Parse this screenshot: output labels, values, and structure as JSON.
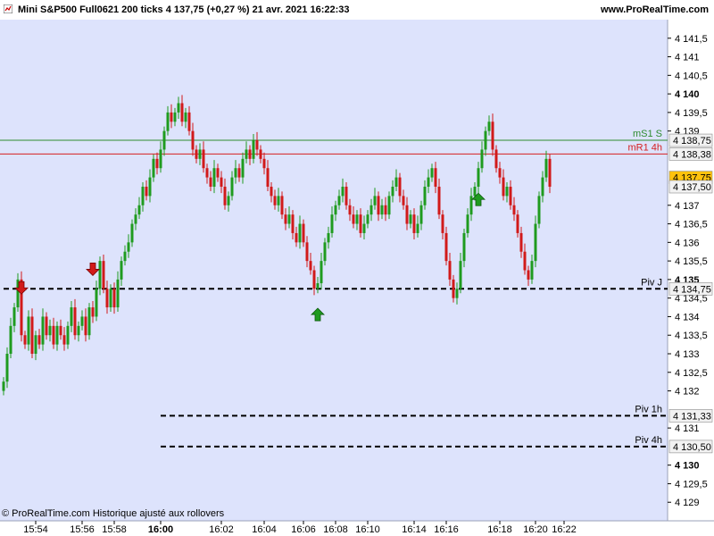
{
  "header": {
    "title": "Mini S&P500 Full0621 200 ticks 4 137,75 (+0,27 %) 21 avr. 2021 16:22:33",
    "site": "www.ProRealTime.com"
  },
  "footer": {
    "credit": "© ProRealTime.com Historique ajusté aux rollovers"
  },
  "colors": {
    "background": "#dde3fc",
    "up": "#1f9b1f",
    "down": "#d11a1a",
    "support_line": "#2e8b2e",
    "resistance_line": "#d42020",
    "last_price_badge": "#ffc20e"
  },
  "chart_data": {
    "type": "candlestick",
    "instrument": "Mini S&P500 Full0621",
    "ylim": [
      4128.5,
      4142
    ],
    "y_ticks": [
      {
        "value": 4141.5,
        "label": "4 141,5"
      },
      {
        "value": 4141,
        "label": "4 141"
      },
      {
        "value": 4140.5,
        "label": "4 140,5"
      },
      {
        "value": 4140,
        "label": "4 140",
        "bold": true
      },
      {
        "value": 4139.5,
        "label": "4 139,5"
      },
      {
        "value": 4139,
        "label": "4 139"
      },
      {
        "value": 4137,
        "label": "4 137"
      },
      {
        "value": 4136.5,
        "label": "4 136,5"
      },
      {
        "value": 4136,
        "label": "4 136"
      },
      {
        "value": 4135.5,
        "label": "4 135,5"
      },
      {
        "value": 4135,
        "label": "4 135",
        "bold": true
      },
      {
        "value": 4134.5,
        "label": "4 134,5"
      },
      {
        "value": 4134,
        "label": "4 134"
      },
      {
        "value": 4133.5,
        "label": "4 133,5"
      },
      {
        "value": 4133,
        "label": "4 133"
      },
      {
        "value": 4132.5,
        "label": "4 132,5"
      },
      {
        "value": 4132,
        "label": "4 132"
      },
      {
        "value": 4131,
        "label": "4 131"
      },
      {
        "value": 4130,
        "label": "4 130",
        "bold": true
      },
      {
        "value": 4129.5,
        "label": "4 129,5"
      },
      {
        "value": 4129,
        "label": "4 129"
      }
    ],
    "x_ticks": [
      {
        "label": "15:54",
        "bar": 9
      },
      {
        "label": "15:56",
        "bar": 22
      },
      {
        "label": "15:58",
        "bar": 31
      },
      {
        "label": "16:00",
        "bar": 44,
        "bold": true
      },
      {
        "label": "16:02",
        "bar": 61
      },
      {
        "label": "16:04",
        "bar": 73
      },
      {
        "label": "16:06",
        "bar": 84
      },
      {
        "label": "16:08",
        "bar": 93
      },
      {
        "label": "16:10",
        "bar": 102
      },
      {
        "label": "16:14",
        "bar": 115
      },
      {
        "label": "16:16",
        "bar": 124
      },
      {
        "label": "16:18",
        "bar": 139
      },
      {
        "label": "16:20",
        "bar": 149
      },
      {
        "label": "16:22",
        "bar": 157
      }
    ],
    "levels": [
      {
        "name": "mS1 S",
        "value": 4138.75,
        "label": "4 138,75",
        "style": "solid",
        "color": "#2e8b2e",
        "badge": "light"
      },
      {
        "name": "mR1 4h",
        "value": 4138.38,
        "label": "4 138,38",
        "style": "solid",
        "color": "#d42020",
        "badge": "light"
      },
      {
        "name": "Piv J",
        "value": 4134.75,
        "label": "4 134,75",
        "style": "dashed",
        "color": "#000000",
        "badge": "light",
        "from_bar": 0
      },
      {
        "name": "Piv 1h",
        "value": 4131.33,
        "label": "4 131,33",
        "style": "dashed",
        "color": "#000000",
        "badge": "light",
        "from_bar": 44
      },
      {
        "name": "Piv 4h",
        "value": 4130.5,
        "label": "4 130,50",
        "style": "dashed",
        "color": "#000000",
        "badge": "light",
        "from_bar": 44
      }
    ],
    "price_labels": [
      {
        "value": 4137.75,
        "label": "4 137,75",
        "badge": "last"
      },
      {
        "value": 4137.5,
        "label": "4 137,50",
        "badge": "light"
      }
    ],
    "close": [
      4132.25,
      4133,
      4133.75,
      4134.25,
      4135,
      4133.5,
      4133.25,
      4134,
      4133,
      4133.5,
      4133.25,
      4134,
      4133.5,
      4133.75,
      4133.25,
      4133.75,
      4133.5,
      4133.25,
      4133.75,
      4134.25,
      4133.5,
      4133.75,
      4134,
      4133.5,
      4134.25,
      4134,
      4134.75,
      4135.5,
      4134.75,
      4134.25,
      4134.75,
      4134.25,
      4135,
      4135.5,
      4135.75,
      4136,
      4136.5,
      4136.75,
      4137,
      4137.5,
      4137.25,
      4137.75,
      4138.25,
      4138,
      4138.5,
      4139,
      4139.5,
      4139.25,
      4139.5,
      4139.75,
      4139.25,
      4139.5,
      4139,
      4138.5,
      4138.25,
      4138.5,
      4138,
      4137.75,
      4137.5,
      4138,
      4137.75,
      4137.5,
      4137,
      4137.25,
      4137.75,
      4138,
      4137.75,
      4138.25,
      4138.5,
      4138.25,
      4138.75,
      4138.5,
      4138.25,
      4138,
      4137.5,
      4137.25,
      4137,
      4137.25,
      4136.75,
      4136.5,
      4136.75,
      4136.25,
      4136,
      4136.5,
      4136,
      4135.5,
      4135.25,
      4134.75,
      4134.9,
      4135.5,
      4136,
      4136.25,
      4136.75,
      4137,
      4137.25,
      4137.5,
      4137,
      4136.75,
      4136.5,
      4136.75,
      4136.25,
      4136.5,
      4136.75,
      4137,
      4137.25,
      4136.75,
      4137,
      4136.75,
      4137.25,
      4137.5,
      4137.75,
      4137.25,
      4137,
      4136.5,
      4136.75,
      4136.25,
      4136.5,
      4137,
      4137.5,
      4137.75,
      4138,
      4137.5,
      4136.75,
      4136.25,
      4135.5,
      4135,
      4134.5,
      4134.75,
      4135.5,
      4136.25,
      4136.75,
      4137.25,
      4137.5,
      4138,
      4138.5,
      4139,
      4139.25,
      4138.5,
      4138,
      4137.75,
      4137.25,
      4137.5,
      4137,
      4136.75,
      4136.25,
      4135.75,
      4135.25,
      4135,
      4135.5,
      4136.5,
      4137.25,
      4137.75,
      4138.25,
      4137.5
    ]
  }
}
